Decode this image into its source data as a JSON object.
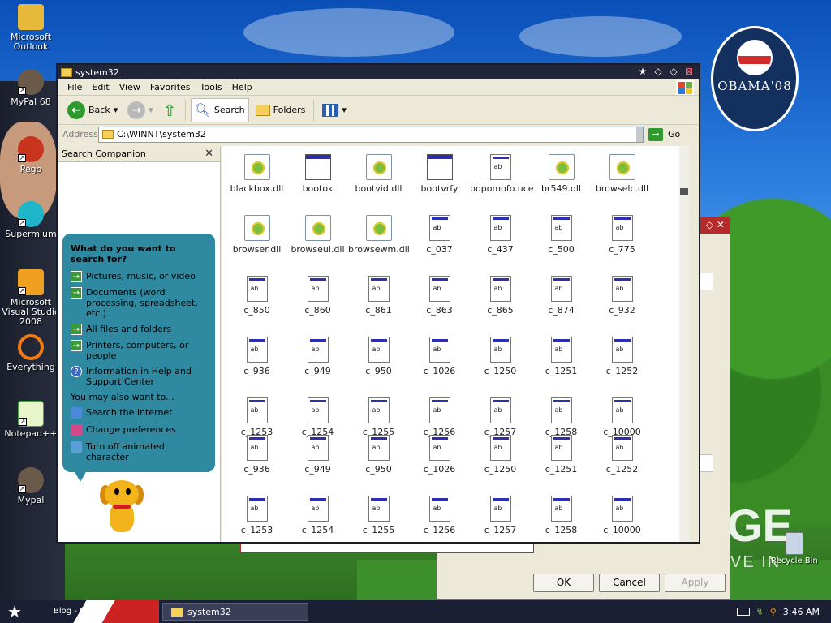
{
  "desktop": {
    "icons": [
      {
        "label": "Microsoft Outlook"
      },
      {
        "label": "MyPal 68"
      },
      {
        "label": "Pego"
      },
      {
        "label": "Supermium"
      },
      {
        "label": "Microsoft Visual Studio 2008"
      },
      {
        "label": "Everything"
      },
      {
        "label": "Notepad++"
      },
      {
        "label": "Mypal"
      }
    ],
    "recycle_bin": "Recycle Bin",
    "wallpaper_badge": "OBAMA'08",
    "wallpaper_big_text": "GE",
    "wallpaper_sub_text": "VE IN"
  },
  "window": {
    "title": "system32",
    "menu": [
      "File",
      "Edit",
      "View",
      "Favorites",
      "Tools",
      "Help"
    ],
    "toolbar": {
      "back": "Back",
      "search": "Search",
      "folders": "Folders"
    },
    "address": {
      "label": "Address",
      "value": "C:\\WINNT\\system32",
      "go": "Go"
    },
    "search_pane": {
      "title": "Search Companion",
      "question": "What do you want to search for?",
      "options": [
        "Pictures, music, or video",
        "Documents (word processing, spreadsheet, etc.)",
        "All files and folders",
        "Printers, computers, or people",
        "Information in Help and Support Center"
      ],
      "also_label": "You may also want to...",
      "links": [
        "Search the Internet",
        "Change preferences",
        "Turn off animated character"
      ]
    },
    "files": [
      {
        "name": "blackbox.dll",
        "type": "dll"
      },
      {
        "name": "bootok",
        "type": "win"
      },
      {
        "name": "bootvid.dll",
        "type": "dll"
      },
      {
        "name": "bootvrfy",
        "type": "win"
      },
      {
        "name": "bopomofo.uce",
        "type": "doc"
      },
      {
        "name": "br549.dll",
        "type": "dll"
      },
      {
        "name": "browselc.dll",
        "type": "dll"
      },
      {
        "name": "browser.dll",
        "type": "dll"
      },
      {
        "name": "browseui.dll",
        "type": "dll"
      },
      {
        "name": "browsewm.dll",
        "type": "dll"
      },
      {
        "name": "c_037",
        "type": "doc"
      },
      {
        "name": "c_437",
        "type": "doc"
      },
      {
        "name": "c_500",
        "type": "doc"
      },
      {
        "name": "c_775",
        "type": "doc"
      },
      {
        "name": "c_850",
        "type": "doc"
      },
      {
        "name": "c_860",
        "type": "doc"
      },
      {
        "name": "c_861",
        "type": "doc"
      },
      {
        "name": "c_863",
        "type": "doc"
      },
      {
        "name": "c_865",
        "type": "doc"
      },
      {
        "name": "c_874",
        "type": "doc"
      },
      {
        "name": "c_932",
        "type": "doc"
      },
      {
        "name": "c_936",
        "type": "doc"
      },
      {
        "name": "c_949",
        "type": "doc"
      },
      {
        "name": "c_950",
        "type": "doc"
      },
      {
        "name": "c_1026",
        "type": "doc"
      },
      {
        "name": "c_1250",
        "type": "doc"
      },
      {
        "name": "c_1251",
        "type": "doc"
      },
      {
        "name": "c_1252",
        "type": "doc"
      },
      {
        "name": "c_1253",
        "type": "doc"
      },
      {
        "name": "c_1254",
        "type": "doc"
      },
      {
        "name": "c_1255",
        "type": "doc"
      },
      {
        "name": "c_1256",
        "type": "doc"
      },
      {
        "name": "c_1257",
        "type": "doc"
      },
      {
        "name": "c_1258",
        "type": "doc"
      },
      {
        "name": "c_10000",
        "type": "doc"
      }
    ],
    "files_repeat": [
      {
        "name": "c_936",
        "type": "doc"
      },
      {
        "name": "c_949",
        "type": "doc"
      },
      {
        "name": "c_950",
        "type": "doc"
      },
      {
        "name": "c_1026",
        "type": "doc"
      },
      {
        "name": "c_1250",
        "type": "doc"
      },
      {
        "name": "c_1251",
        "type": "doc"
      },
      {
        "name": "c_1252",
        "type": "doc"
      },
      {
        "name": "c_1253",
        "type": "doc"
      },
      {
        "name": "c_1254",
        "type": "doc"
      },
      {
        "name": "c_1255",
        "type": "doc"
      },
      {
        "name": "c_1256",
        "type": "doc"
      },
      {
        "name": "c_1257",
        "type": "doc"
      },
      {
        "name": "c_1258",
        "type": "doc"
      },
      {
        "name": "c_10000",
        "type": "doc"
      }
    ]
  },
  "dialog": {
    "ok": "OK",
    "cancel": "Cancel",
    "apply": "Apply"
  },
  "taskbar": {
    "quicklaunch_text": "Blog - Mus",
    "task": "system32",
    "clock": "3:46 AM"
  },
  "colors": {
    "titlebar": "#22263a",
    "accent_red": "#b52a2a",
    "search_bubble": "#2f89a0"
  }
}
